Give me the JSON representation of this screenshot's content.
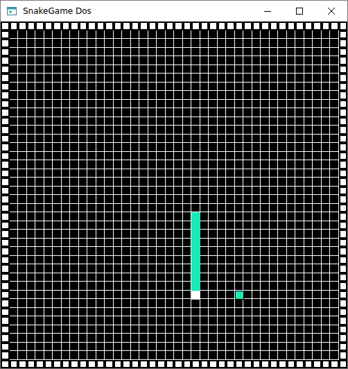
{
  "window": {
    "title": "SnakeGame Dos"
  },
  "board": {
    "cols": 40,
    "rows": 40
  },
  "snake": {
    "segments": [
      {
        "kind": "body",
        "col": 22,
        "row": 22,
        "color": "#1ce8b5"
      },
      {
        "kind": "body",
        "col": 22,
        "row": 23,
        "color": "#1ce8b5"
      },
      {
        "kind": "body",
        "col": 22,
        "row": 24,
        "color": "#1ce8b5"
      },
      {
        "kind": "body",
        "col": 22,
        "row": 25,
        "color": "#1ce8b5"
      },
      {
        "kind": "body",
        "col": 22,
        "row": 26,
        "color": "#1ce8b5"
      },
      {
        "kind": "body",
        "col": 22,
        "row": 27,
        "color": "#1ce8b5"
      },
      {
        "kind": "body",
        "col": 22,
        "row": 28,
        "color": "#1ce8b5"
      },
      {
        "kind": "body",
        "col": 22,
        "row": 29,
        "color": "#1ce8b5"
      },
      {
        "kind": "body",
        "col": 22,
        "row": 30,
        "color": "#1ce8b5"
      },
      {
        "kind": "head",
        "col": 22,
        "row": 31,
        "color": "#ffffff"
      }
    ]
  },
  "food": {
    "col": 27,
    "row": 31,
    "color": "#1ce8b5"
  }
}
